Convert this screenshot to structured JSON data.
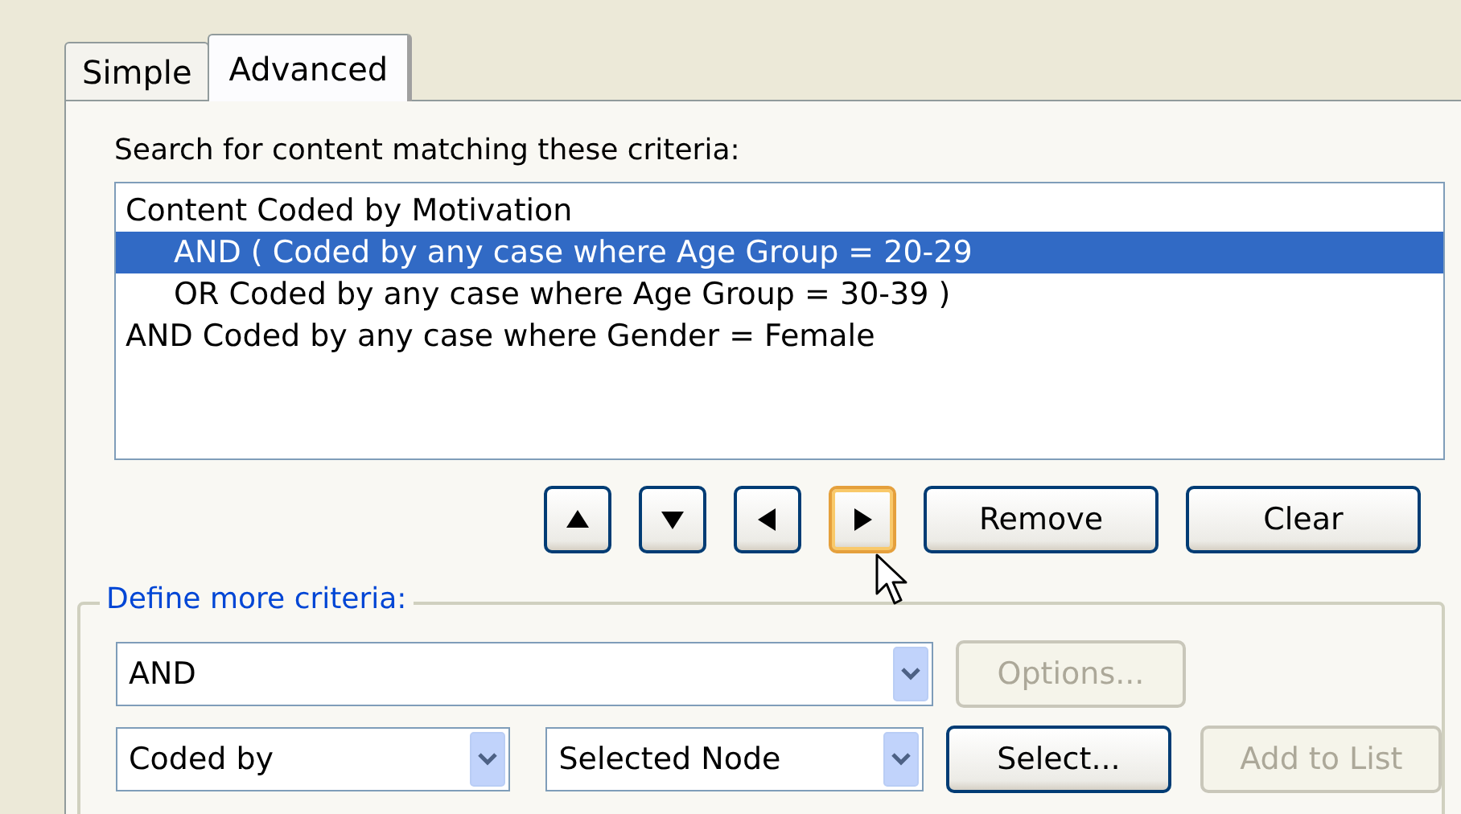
{
  "tabs": [
    {
      "label": "Simple",
      "selected": false
    },
    {
      "label": "Advanced",
      "selected": true
    }
  ],
  "criteria_label": "Search for content matching these criteria:",
  "criteria": [
    {
      "text": "Content Coded by Motivation",
      "selected": false,
      "children": [
        {
          "text": "AND ( Coded by any case where Age Group = 20-29",
          "selected": true
        },
        {
          "text": "OR Coded by any case where Age Group = 30-39 )",
          "selected": false
        }
      ]
    },
    {
      "text": "AND Coded by any case where Gender = Female",
      "selected": false
    }
  ],
  "move_buttons": [
    {
      "kind": "up",
      "hovered": false
    },
    {
      "kind": "down",
      "hovered": false
    },
    {
      "kind": "left",
      "hovered": false
    },
    {
      "kind": "right",
      "hovered": true
    }
  ],
  "list_buttons": [
    {
      "label": "Remove",
      "disabled": false
    },
    {
      "label": "Clear",
      "disabled": false
    }
  ],
  "define": {
    "title": "Define more criteria:",
    "operator": {
      "value": "AND"
    },
    "options_button": {
      "label": "Options...",
      "disabled": true
    },
    "condition": {
      "value": "Coded by"
    },
    "scope": {
      "value": "Selected Node"
    },
    "select_button": {
      "label": "Select...",
      "disabled": false
    },
    "add_button": {
      "label": "Add to List",
      "disabled": true
    }
  }
}
